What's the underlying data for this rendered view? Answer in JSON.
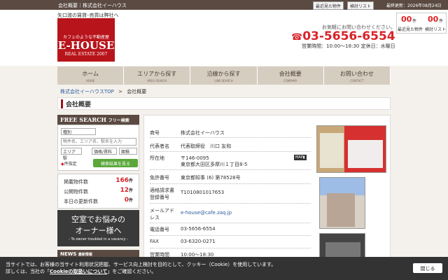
{
  "topbar": {
    "title": "会社概要｜株式会社イーハウス",
    "recent": "最近見た物件",
    "review": "検討リスト",
    "updated": "最終更新：2026年08月24日"
  },
  "header": {
    "tagline": "矢口渡の賃貸･売買は弊社へ",
    "logo_sub": "カフェのような不動産屋",
    "logo_main": "E-HOUSE",
    "logo_est": "REAL ESTATE 2007",
    "tel_msg": "お気軽にお問い合わせください。",
    "phone": "03-5656-6554",
    "hours": "営業時間：10:00～18:30 定休日：水曜日"
  },
  "fav": {
    "recent_count": "00",
    "recent_unit": "件",
    "recent_label": "最近見た物件",
    "review_count": "00",
    "review_unit": "件",
    "review_label": "検討リスト"
  },
  "gnav": [
    {
      "ja": "ホーム",
      "en": "HOME"
    },
    {
      "ja": "エリアから探す",
      "en": "AREA SEARCH"
    },
    {
      "ja": "沿線から探す",
      "en": "LINE SEARCH"
    },
    {
      "ja": "会社概要",
      "en": "COMPANY"
    },
    {
      "ja": "お問い合わせ",
      "en": "CONTACT"
    }
  ],
  "breadcrumb": {
    "home": "株式会社イーハウスTOP",
    "sep": ">",
    "current": "会社概要"
  },
  "page_title": "会社概要",
  "search": {
    "header": "FREE SEARCH",
    "header_jp": "フリー検索",
    "type": "種別",
    "keyword_ph": "物件名、エリア名、駅名を入力",
    "area": "エリア",
    "station": "駅",
    "price": "価格/賃料",
    "size": "面積",
    "cond": "件指定",
    "btn": "検索結果を見る"
  },
  "stats": [
    {
      "label": "掲載物件数",
      "value": "166",
      "unit": "件"
    },
    {
      "label": "公開物件数",
      "value": "12",
      "unit": "件"
    },
    {
      "label": "本日の更新件数",
      "value": "0",
      "unit": "件"
    }
  ],
  "owner": {
    "line1": "空室でお悩みの",
    "line2": "オーナー様へ",
    "line3": "- To owner troubled in a vacancy -"
  },
  "news": {
    "title": "NEWS",
    "sub": "最新情報"
  },
  "company": [
    {
      "k": "商号",
      "v": "株式会社イーハウス"
    },
    {
      "k": "代表者名",
      "v": "代表取締役　川口 友和"
    },
    {
      "k": "所在地",
      "v": "〒146-0095",
      "v2": "東京都大田区多摩川１丁目8-5",
      "map": "MAP"
    },
    {
      "k": "免許番号",
      "v": "東京都知事 (6) 第78528号"
    },
    {
      "k": "適格請求書登録番号",
      "v": "T1010801017653"
    },
    {
      "k": "メールアドレス",
      "v": "e-house@cafe.zaq.jp"
    },
    {
      "k": "電話番号",
      "v": "03-5656-6554"
    },
    {
      "k": "FAX",
      "v": "03-6320-0271"
    },
    {
      "k": "営業時間",
      "v": "10:00～18:30"
    }
  ],
  "cookie": {
    "line1": "当サイトでは、お客様の当サイト利用状況把握、サービス向上検討を目的として、クッキー（Cookie）を使用しています。",
    "line2a": "詳しくは、当社の「",
    "link": "Cookieの取扱いについて",
    "line2b": "」をご確認ください。",
    "close": "閉じる"
  }
}
